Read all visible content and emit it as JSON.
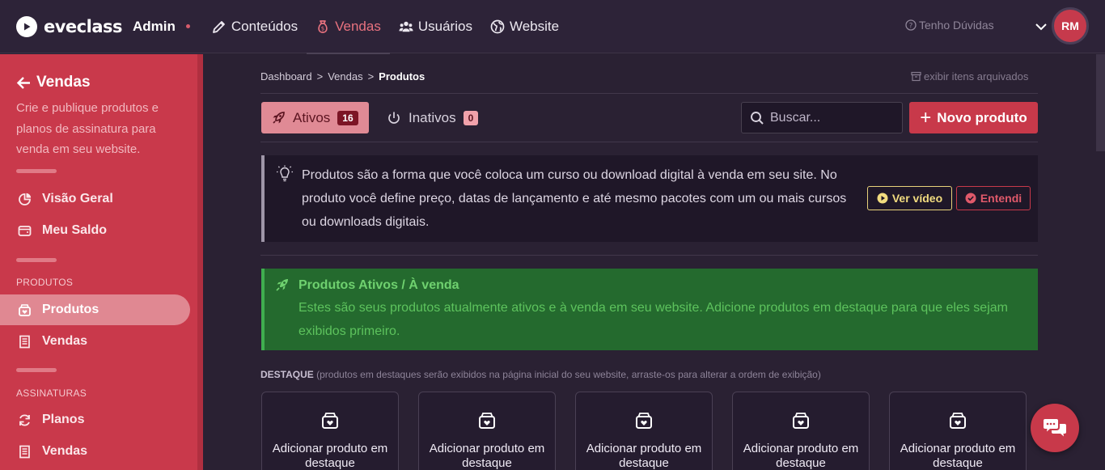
{
  "brand": {
    "name": "eveclass",
    "admin_label": "Admin"
  },
  "nav": {
    "items": [
      {
        "label": "Conteúdos",
        "icon": "pencil-icon"
      },
      {
        "label": "Vendas",
        "icon": "moneybag-icon",
        "active": true
      },
      {
        "label": "Usuários",
        "icon": "users-icon"
      },
      {
        "label": "Website",
        "icon": "globe-icon"
      }
    ],
    "help_label": "Tenho Dúvidas",
    "avatar_initials": "RM"
  },
  "sidebar": {
    "title": "Vendas",
    "description": "Crie e publique produtos e planos de assinatura para venda em seu website.",
    "items_main": [
      {
        "label": "Visão Geral",
        "icon": "pie-chart-icon"
      },
      {
        "label": "Meu Saldo",
        "icon": "wallet-icon"
      }
    ],
    "section_products": "PRODUTOS",
    "items_products": [
      {
        "label": "Produtos",
        "icon": "product-box-icon",
        "active": true
      },
      {
        "label": "Vendas",
        "icon": "receipt-icon"
      }
    ],
    "section_subscriptions": "ASSINATURAS",
    "items_subscriptions": [
      {
        "label": "Planos",
        "icon": "refresh-icon"
      },
      {
        "label": "Vendas",
        "icon": "receipt-icon"
      }
    ]
  },
  "breadcrumb": {
    "items": [
      "Dashboard",
      "Vendas",
      "Produtos"
    ]
  },
  "archived_label": "exibir itens arquivados",
  "tabs": {
    "active": {
      "label": "Ativos",
      "count": "16"
    },
    "inactive": {
      "label": "Inativos",
      "count": "0"
    }
  },
  "search": {
    "placeholder": "Buscar..."
  },
  "new_product_label": "Novo produto",
  "info": {
    "text": "Produtos são a forma que você coloca um curso ou download digital à venda em seu site. No produto você define preço, datas de lançamento e até mesmo pacotes com um ou mais cursos ou downloads digitais.",
    "video_label": "Ver vídeo",
    "ok_label": "Entendi"
  },
  "success": {
    "title": "Produtos Ativos / À venda",
    "text": "Estes são seus produtos atualmente ativos e à venda em seu website. Adicione produtos em destaque para que eles sejam exibidos primeiro."
  },
  "destaque": {
    "label": "DESTAQUE",
    "hint": "(produtos em destaques serão exibidos na página inicial do seu website, arraste-os para alterar a ordem de exibição)"
  },
  "cards": [
    {
      "label": "Adicionar produto em destaque"
    },
    {
      "label": "Adicionar produto em destaque"
    },
    {
      "label": "Adicionar produto em destaque"
    },
    {
      "label": "Adicionar produto em destaque"
    },
    {
      "label": "Adicionar produto em destaque"
    }
  ],
  "colors": {
    "accent": "#c8394a",
    "sidebar": "#c9394b",
    "success_bg": "#246a2e",
    "video_yellow": "#f2dc7f"
  }
}
